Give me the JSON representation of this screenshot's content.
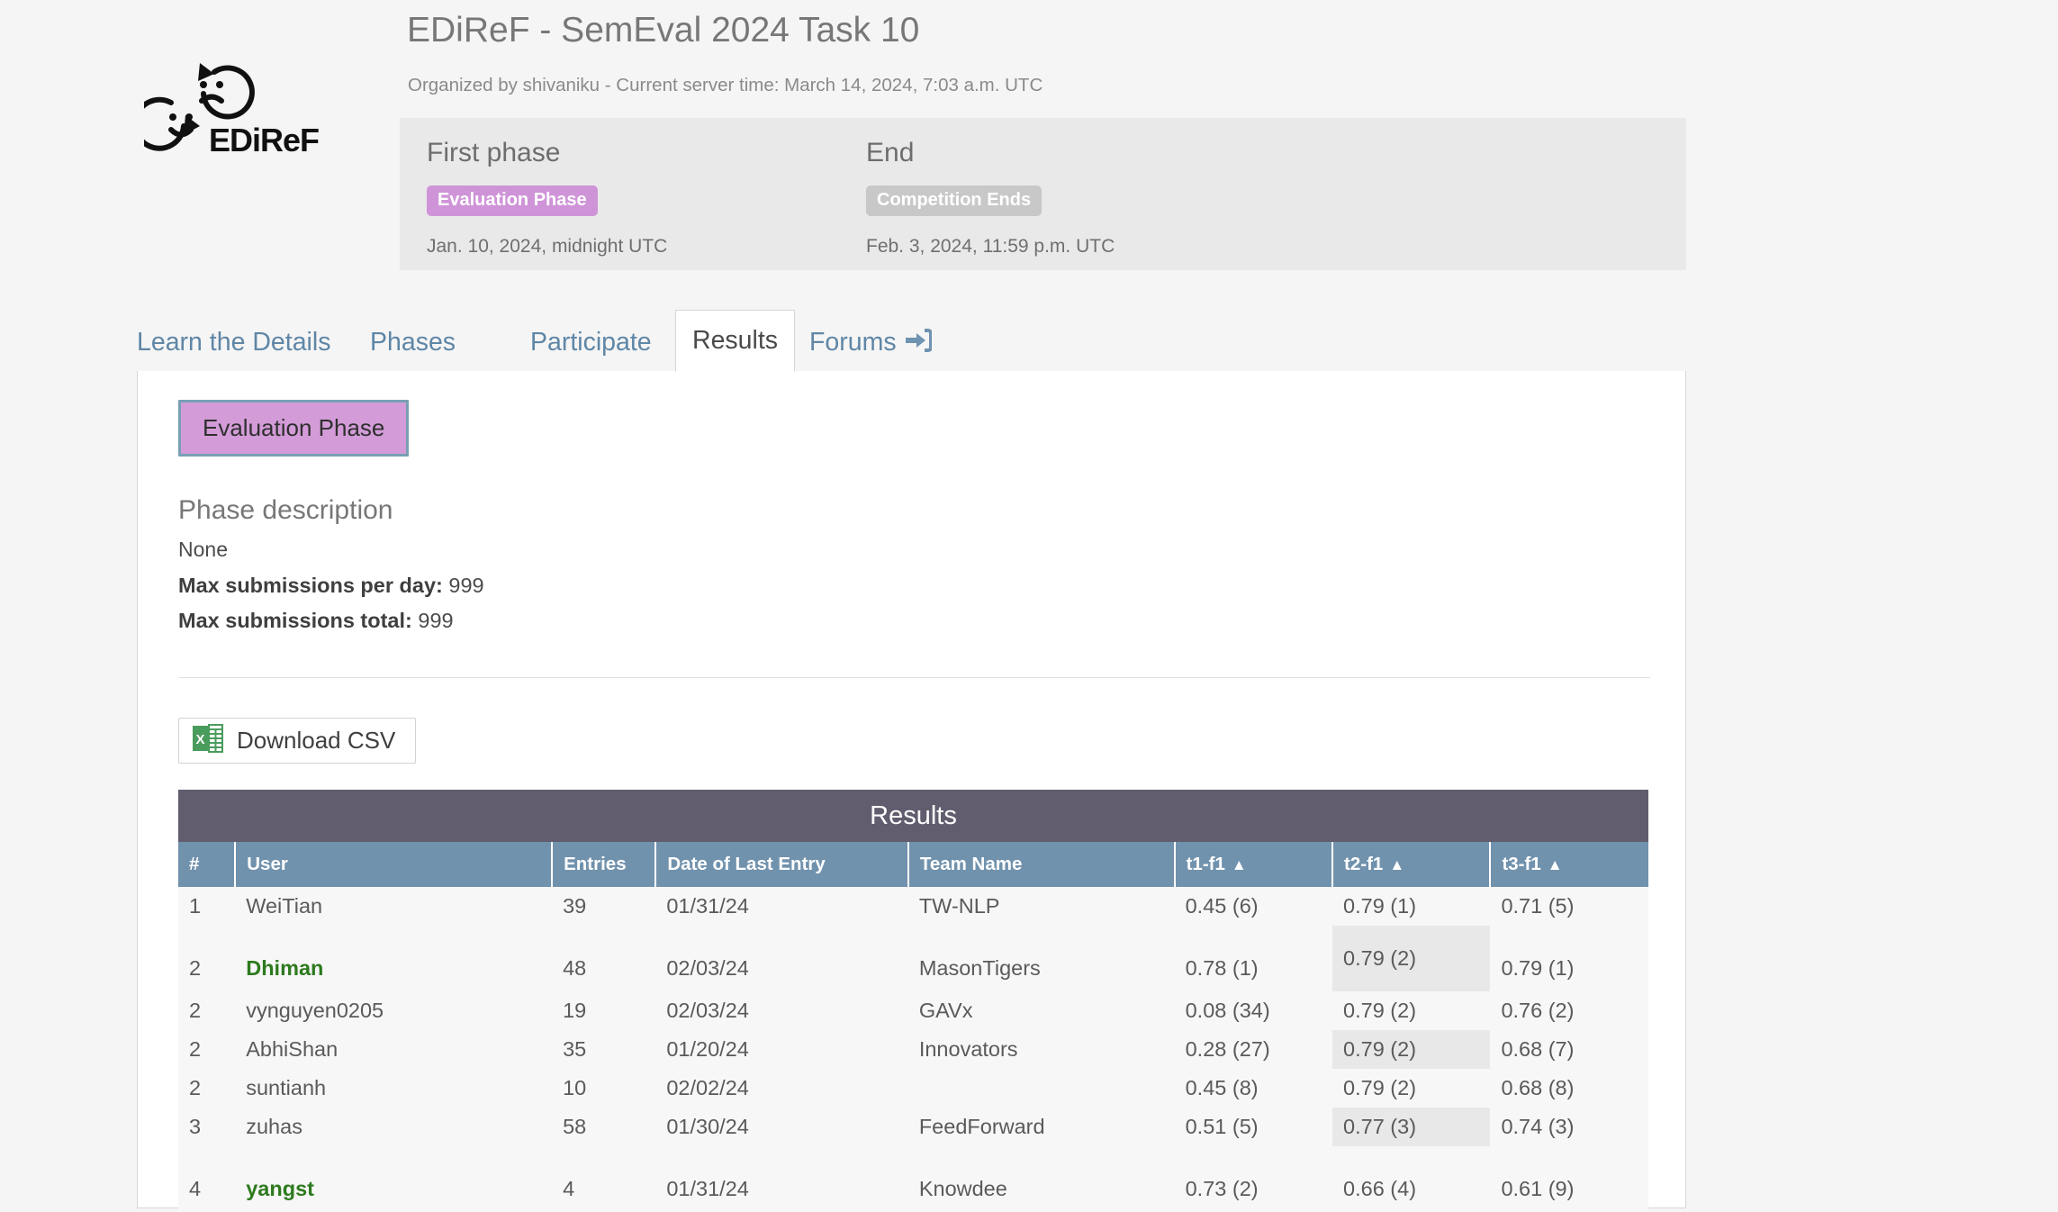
{
  "header": {
    "logo_alt": "EDiReF logo",
    "logo_wordmark": "EDiReF",
    "title": "EDiReF - SemEval 2024 Task 10",
    "subtitle": "Organized by shivaniku - Current server time: March 14, 2024, 7:03 a.m. UTC"
  },
  "phase_box": {
    "first": {
      "title": "First phase",
      "badge": "Evaluation Phase",
      "date": "Jan. 10, 2024, midnight UTC"
    },
    "end": {
      "title": "End",
      "badge": "Competition Ends",
      "date": "Feb. 3, 2024, 11:59 p.m. UTC"
    }
  },
  "tabs": [
    {
      "label": "Learn the Details",
      "active": false
    },
    {
      "label": "Phases",
      "active": false
    },
    {
      "label": "Participate",
      "active": false
    },
    {
      "label": "Results",
      "active": true
    },
    {
      "label": "Forums",
      "active": false,
      "icon": "sign-in-icon"
    }
  ],
  "panel": {
    "phase_button": "Evaluation Phase",
    "phase_description_title": "Phase description",
    "phase_description_value": "None",
    "max_per_day_label": "Max submissions per day:",
    "max_per_day_value": "999",
    "max_total_label": "Max submissions total:",
    "max_total_value": "999",
    "download_csv_label": "Download CSV",
    "download_csv_icon": "excel-file-icon"
  },
  "results": {
    "caption": "Results",
    "columns": [
      {
        "key": "rank",
        "label": "#",
        "sortable": false
      },
      {
        "key": "user",
        "label": "User",
        "sortable": false
      },
      {
        "key": "entries",
        "label": "Entries",
        "sortable": false
      },
      {
        "key": "date",
        "label": "Date of Last Entry",
        "sortable": false
      },
      {
        "key": "team",
        "label": "Team Name",
        "sortable": false
      },
      {
        "key": "t1",
        "label": "t1-f1",
        "sortable": true,
        "caret": "▲"
      },
      {
        "key": "t2",
        "label": "t2-f1",
        "sortable": true,
        "caret": "▲"
      },
      {
        "key": "t3",
        "label": "t3-f1",
        "sortable": true,
        "caret": "▲"
      }
    ],
    "rows": [
      {
        "rank": "1",
        "user": "WeiTian",
        "own": false,
        "entries": "39",
        "date": "01/31/24",
        "team": "TW-NLP",
        "t1": "0.45 (6)",
        "t2": "0.79 (1)",
        "t3": "0.71 (5)",
        "t2_highlight": false,
        "tall": false
      },
      {
        "rank": "2",
        "user": "Dhiman",
        "own": true,
        "entries": "48",
        "date": "02/03/24",
        "team": "MasonTigers",
        "t1": "0.78 (1)",
        "t2": "0.79 (2)",
        "t3": "0.79 (1)",
        "t2_highlight": true,
        "tall": true
      },
      {
        "rank": "2",
        "user": "vynguyen0205",
        "own": false,
        "entries": "19",
        "date": "02/03/24",
        "team": "GAVx",
        "t1": "0.08 (34)",
        "t2": "0.79 (2)",
        "t3": "0.76 (2)",
        "t2_highlight": false,
        "tall": false
      },
      {
        "rank": "2",
        "user": "AbhiShan",
        "own": false,
        "entries": "35",
        "date": "01/20/24",
        "team": "Innovators",
        "t1": "0.28 (27)",
        "t2": "0.79 (2)",
        "t3": "0.68 (7)",
        "t2_highlight": true,
        "tall": false
      },
      {
        "rank": "2",
        "user": "suntianh",
        "own": false,
        "entries": "10",
        "date": "02/02/24",
        "team": "",
        "t1": "0.45 (8)",
        "t2": "0.79 (2)",
        "t3": "0.68 (8)",
        "t2_highlight": false,
        "tall": false
      },
      {
        "rank": "3",
        "user": "zuhas",
        "own": false,
        "entries": "58",
        "date": "01/30/24",
        "team": "FeedForward",
        "t1": "0.51 (5)",
        "t2": "0.77 (3)",
        "t3": "0.74 (3)",
        "t2_highlight": true,
        "tall": false
      },
      {
        "rank": "4",
        "user": "yangst",
        "own": true,
        "entries": "4",
        "date": "01/31/24",
        "team": "Knowdee",
        "t1": "0.73 (2)",
        "t2": "0.66 (4)",
        "t3": "0.61 (9)",
        "t2_highlight": false,
        "tall": true
      }
    ]
  },
  "colors": {
    "page_bg": "#f5f5f5",
    "panel_bg": "#ffffff",
    "phase_box_bg": "#e9e9e9",
    "badge_eval": "#cf94d8",
    "badge_ends": "#c8c8c8",
    "tab_link": "#5f86a6",
    "results_caption_bg": "#615d6e",
    "results_header_bg": "#7192ad",
    "row_bg": "#f7f7f7",
    "cell_highlight": "#e8e8e8",
    "own_user_green": "#2d7a1e",
    "excel_green": "#4a9c5c"
  }
}
